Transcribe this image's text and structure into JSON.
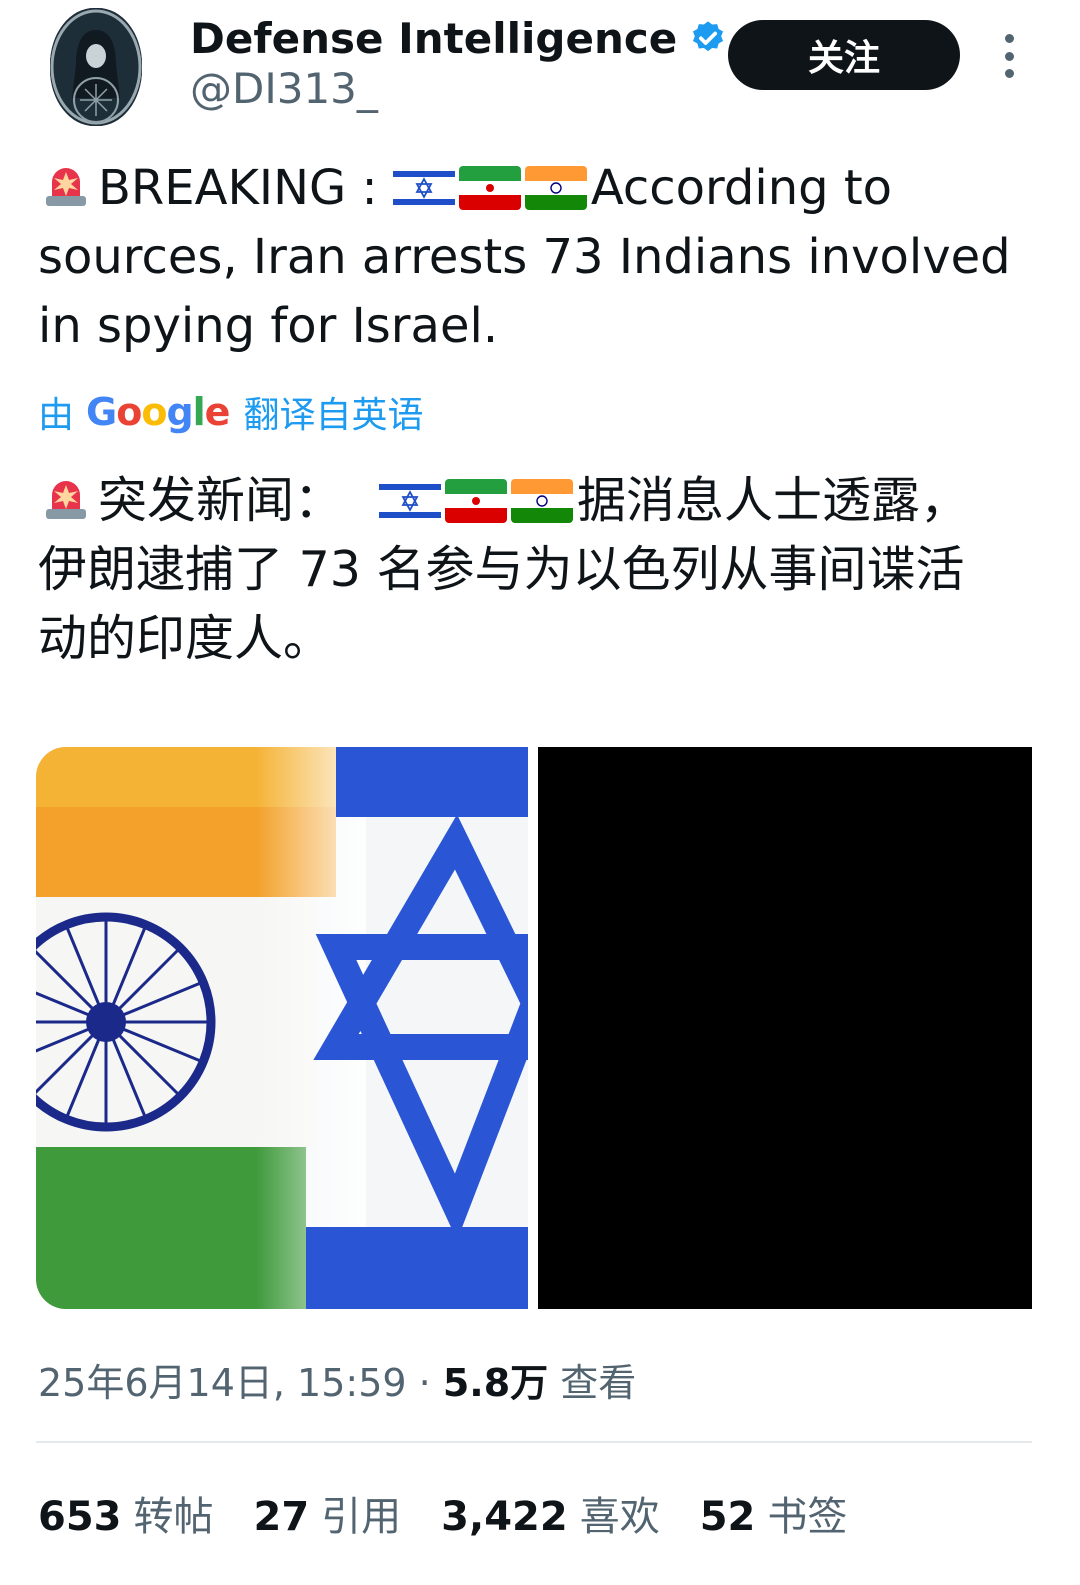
{
  "author": {
    "display_name": "Defense Intelligence",
    "handle": "@DI313_",
    "verified": true
  },
  "follow_label": "关注",
  "tweet": {
    "original": {
      "prefix": "BREAKING : ",
      "line1_suffix": "According to",
      "line2": "sources, Iran arrests 73 Indians involved",
      "line3": "in spying for Israel."
    },
    "translation_notice": {
      "prefix": "由",
      "brand": "Google",
      "suffix": "翻译自英语"
    },
    "translated": {
      "prefix": "突发新闻：",
      "line1_suffix": "据消息人士透露，",
      "line2": "伊朗逮捕了 73 名参与为以色列从事间谍活",
      "line3": "动的印度人。"
    },
    "emoji": [
      "siren",
      "israel-flag",
      "iran-flag",
      "india-flag"
    ]
  },
  "meta": {
    "date": "25年6月14日, 15:59",
    "separator": "·",
    "views_count": "5.8万",
    "views_label": "查看"
  },
  "stats": [
    {
      "count": "653",
      "label": "转帖"
    },
    {
      "count": "27",
      "label": "引用"
    },
    {
      "count": "3,422",
      "label": "喜欢"
    },
    {
      "count": "52",
      "label": "书签"
    }
  ],
  "colors": {
    "text": "#0f1419",
    "secondary": "#536471",
    "link": "#1d9bf0",
    "button_bg": "#0f1419"
  }
}
